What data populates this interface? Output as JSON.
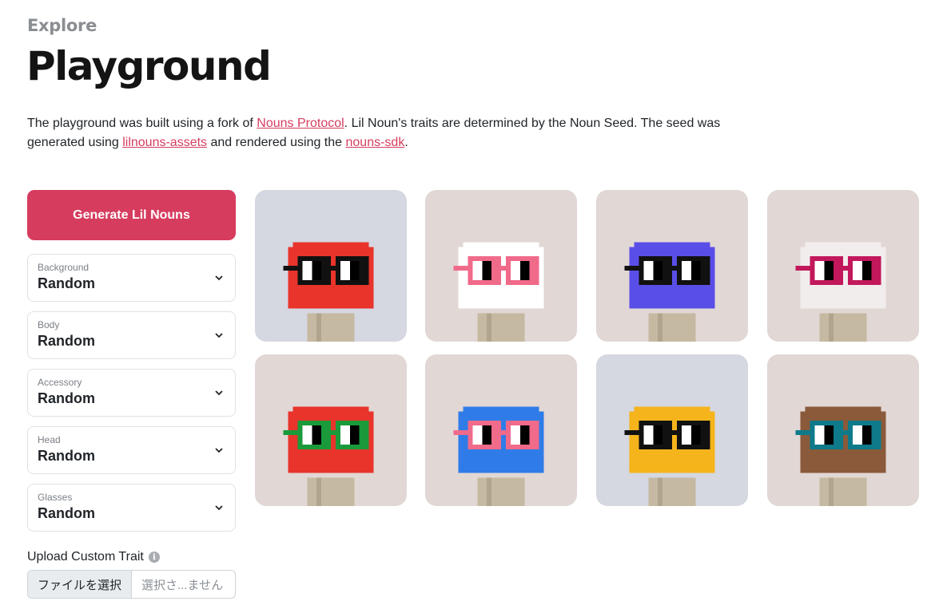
{
  "header": {
    "eyebrow": "Explore",
    "title": "Playground"
  },
  "description": {
    "part1": "The playground was built using a fork of ",
    "link1": "Nouns Protocol",
    "part2": ". Lil Noun's traits are determined by the Noun Seed. The seed was generated using ",
    "link2": "lilnouns-assets",
    "part3": " and rendered using the ",
    "link3": "nouns-sdk",
    "part4": "."
  },
  "controls": {
    "generate_label": "Generate Lil Nouns",
    "selects": [
      {
        "label": "Background",
        "value": "Random"
      },
      {
        "label": "Body",
        "value": "Random"
      },
      {
        "label": "Accessory",
        "value": "Random"
      },
      {
        "label": "Head",
        "value": "Random"
      },
      {
        "label": "Glasses",
        "value": "Random"
      }
    ],
    "upload_label": "Upload Custom Trait",
    "file_button": "ファイルを選択",
    "file_placeholder": "選択さ...ません"
  },
  "colors": {
    "accent": "#d63c5e",
    "bg_cool": "#d5d7e1",
    "bg_warm": "#e1d7d5"
  },
  "nouns": [
    {
      "bg": "#d5d7e1",
      "head": "#e8342b",
      "glasses": "#111111"
    },
    {
      "bg": "#e1d7d5",
      "head": "#ffffff",
      "glasses": "#f06a8a"
    },
    {
      "bg": "#e1d7d5",
      "head": "#5a4ee8",
      "glasses": "#111111"
    },
    {
      "bg": "#e1d7d5",
      "head": "#f2eded",
      "glasses": "#c2185b"
    },
    {
      "bg": "#e1d7d5",
      "head": "#e8342b",
      "glasses": "#1a9a3a"
    },
    {
      "bg": "#e1d7d5",
      "head": "#2f7ce8",
      "glasses": "#f06a8a"
    },
    {
      "bg": "#d5d7e1",
      "head": "#f5b41c",
      "glasses": "#111111"
    },
    {
      "bg": "#e1d7d5",
      "head": "#8a5a3a",
      "glasses": "#0e7a8a"
    }
  ]
}
